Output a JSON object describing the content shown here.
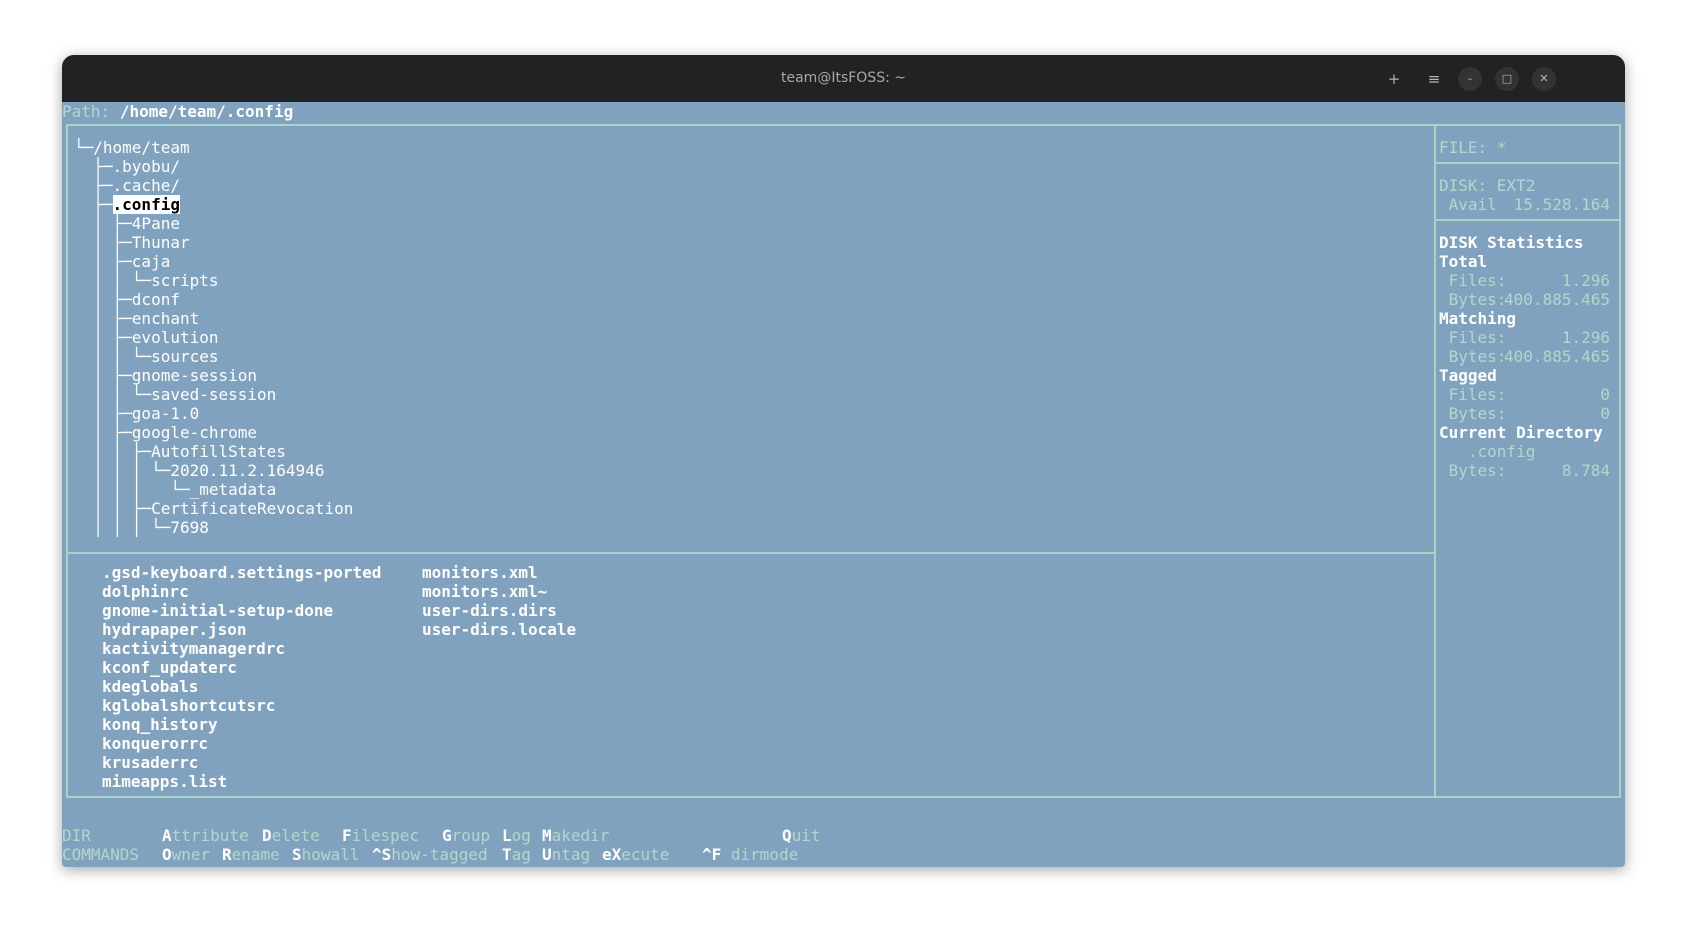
{
  "window": {
    "title": "team@ItsFOSS: ~"
  },
  "titlebar_icons": [
    "new-tab-icon",
    "menu-icon",
    "minimize-icon",
    "maximize-icon",
    "close-icon"
  ],
  "path": {
    "label": "Path:",
    "value": "/home/team/.config"
  },
  "tree": [
    {
      "prefix": "└─",
      "name": "/home/team"
    },
    {
      "prefix": "  ├─",
      "name": ".byobu/"
    },
    {
      "prefix": "  ├─",
      "name": ".cache/"
    },
    {
      "prefix": "  ├─",
      "name": ".config",
      "selected": true
    },
    {
      "prefix": "  │ ├─",
      "name": "4Pane"
    },
    {
      "prefix": "  │ ├─",
      "name": "Thunar"
    },
    {
      "prefix": "  │ ├─",
      "name": "caja"
    },
    {
      "prefix": "  │ │ └─",
      "name": "scripts"
    },
    {
      "prefix": "  │ ├─",
      "name": "dconf"
    },
    {
      "prefix": "  │ ├─",
      "name": "enchant"
    },
    {
      "prefix": "  │ ├─",
      "name": "evolution"
    },
    {
      "prefix": "  │ │ └─",
      "name": "sources"
    },
    {
      "prefix": "  │ ├─",
      "name": "gnome-session"
    },
    {
      "prefix": "  │ │ └─",
      "name": "saved-session"
    },
    {
      "prefix": "  │ ├─",
      "name": "goa-1.0"
    },
    {
      "prefix": "  │ ├─",
      "name": "google-chrome"
    },
    {
      "prefix": "  │ │ ├─",
      "name": "AutofillStates"
    },
    {
      "prefix": "  │ │ │ └─",
      "name": "2020.11.2.164946"
    },
    {
      "prefix": "  │ │ │   └─",
      "name": "_metadata"
    },
    {
      "prefix": "  │ │ ├─",
      "name": "CertificateRevocation"
    },
    {
      "prefix": "  │ │ │ └─",
      "name": "7698"
    }
  ],
  "files_col1": [
    ".gsd-keyboard.settings-ported",
    "dolphinrc",
    "gnome-initial-setup-done",
    "hydrapaper.json",
    "kactivitymanagerdrc",
    "kconf_updaterc",
    "kdeglobals",
    "kglobalshortcutsrc",
    "konq_history",
    "konquerorrc",
    "krusaderrc",
    "mimeapps.list"
  ],
  "files_col2": [
    "monitors.xml",
    "monitors.xml~",
    "user-dirs.dirs",
    "user-dirs.locale"
  ],
  "info": {
    "file_label": "FILE: *",
    "disk_label": "DISK: EXT2",
    "avail_label": " Avail",
    "avail_value": "15.528.164",
    "stats_title": "DISK Statistics",
    "total_label": "Total",
    "total_files_label": " Files:",
    "total_files_value": "1.296",
    "total_bytes_label": " Bytes:",
    "total_bytes_value": "400.885.465",
    "matching_label": "Matching",
    "matching_files_label": " Files:",
    "matching_files_value": "1.296",
    "matching_bytes_label": " Bytes:",
    "matching_bytes_value": "400.885.465",
    "tagged_label": "Tagged",
    "tagged_files_label": " Files:",
    "tagged_files_value": "0",
    "tagged_bytes_label": " Bytes:",
    "tagged_bytes_value": "0",
    "current_label": "Current Directory",
    "current_dir": "   .config",
    "current_bytes_label": " Bytes:",
    "current_bytes_value": "8.784"
  },
  "commands": {
    "row1_label": "DIR",
    "row2_label": "COMMANDS",
    "row1": [
      {
        "key": "A",
        "rest": "ttribute"
      },
      {
        "key": "D",
        "rest": "elete"
      },
      {
        "key": "F",
        "rest": "ilespec"
      },
      {
        "key": "G",
        "rest": "roup"
      },
      {
        "key": "L",
        "rest": "og"
      },
      {
        "key": "M",
        "rest": "akedir"
      },
      {
        "key": "Q",
        "rest": "uit"
      }
    ],
    "row2": [
      {
        "key": "O",
        "rest": "wner"
      },
      {
        "key": "R",
        "rest": "ename"
      },
      {
        "key": "S",
        "rest": "howall"
      },
      {
        "key": "^S",
        "rest": "how-tagged"
      },
      {
        "key": "T",
        "rest": "ag"
      },
      {
        "key": "U",
        "rest": "ntag"
      },
      {
        "key": "eX",
        "rest": "ecute"
      },
      {
        "key": "^F",
        "rest": " dirmode"
      }
    ]
  }
}
